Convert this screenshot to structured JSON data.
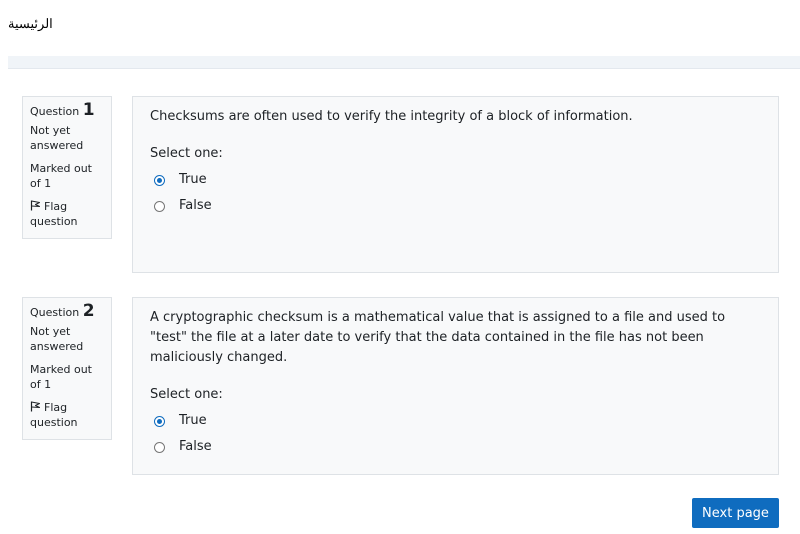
{
  "header": {
    "home_label": "الرئيسية"
  },
  "questions": [
    {
      "label": "Question",
      "number": "1",
      "state": "Not yet answered",
      "grade": "Marked out of 1",
      "flag_label": "Flag question",
      "text": "Checksums are often used to verify the integrity of a block of information.",
      "prompt": "Select one:",
      "options": [
        {
          "label": "True",
          "selected": true
        },
        {
          "label": "False",
          "selected": false
        }
      ]
    },
    {
      "label": "Question",
      "number": "2",
      "state": "Not yet answered",
      "grade": "Marked out of 1",
      "flag_label": "Flag question",
      "text": "A cryptographic checksum is a mathematical value that is assigned to a file and used to \"test\" the file at a later date to verify that the data contained in the file has not been maliciously changed.",
      "prompt": "Select one:",
      "options": [
        {
          "label": "True",
          "selected": true
        },
        {
          "label": "False",
          "selected": false
        }
      ]
    }
  ],
  "navigation": {
    "next_label": "Next page"
  },
  "colors": {
    "accent": "#0f6cbf",
    "panel_bg": "#f8f9fa",
    "panel_border": "#dee2e6"
  },
  "icons": {
    "flag": "flag-icon"
  }
}
